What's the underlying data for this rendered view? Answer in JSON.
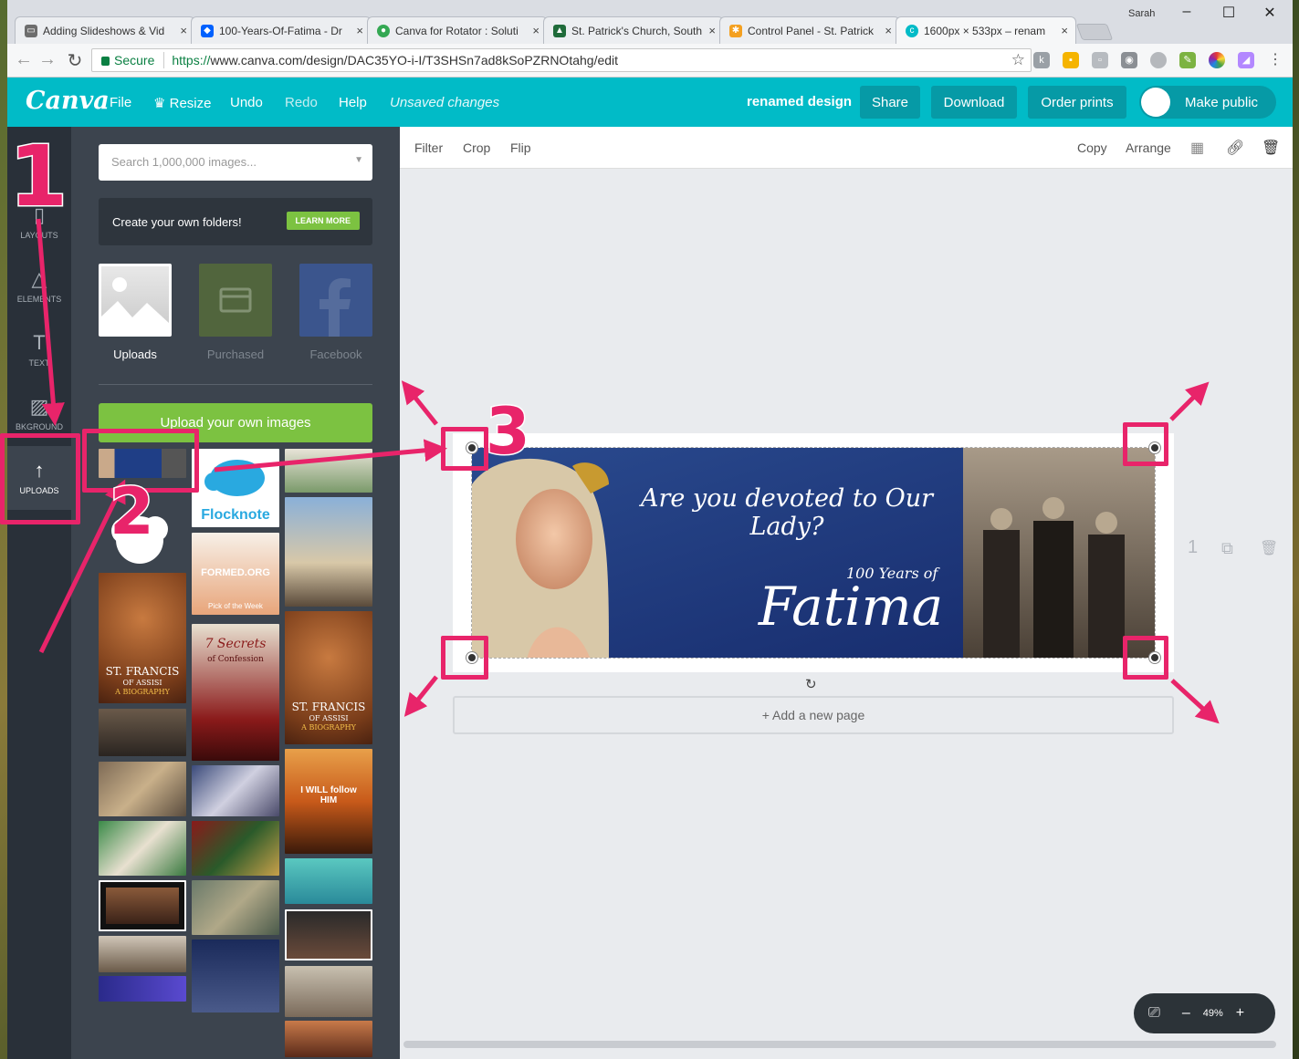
{
  "browser": {
    "tabs": [
      {
        "title": "Adding Slideshows & Vid",
        "fav_color": "#6d6d6d"
      },
      {
        "title": "100-Years-Of-Fatima - Dr",
        "fav_color": "#0061fe"
      },
      {
        "title": "Canva for Rotator : Soluti",
        "fav_color": "#34a853"
      },
      {
        "title": "St. Patrick's Church, South",
        "fav_color": "#1f6b3a"
      },
      {
        "title": "Control Panel - St. Patrick",
        "fav_color": "#f4a020"
      },
      {
        "title": "1600px × 533px – renam",
        "fav_color": "#01bbc7"
      }
    ],
    "close_glyph": "×",
    "profile_name": "Sarah",
    "secure_label": "Secure",
    "url_scheme": "https://",
    "url_rest": "www.canva.com/design/DAC35YO-i-I/T3SHSn7ad8kSoPZRNOtahg/edit"
  },
  "canva": {
    "logo": "Canva",
    "menu": {
      "file": "File",
      "resize": "Resize",
      "undo": "Undo",
      "redo": "Redo",
      "help": "Help",
      "status": "Unsaved changes"
    },
    "design_name": "renamed design",
    "buttons": {
      "share": "Share",
      "download": "Download",
      "order_prints": "Order prints",
      "make_public": "Make public"
    },
    "rail": {
      "layouts": "LAYOUTS",
      "elements": "ELEMENTS",
      "text": "TEXT",
      "background": "BKGROUND",
      "uploads": "UPLOADS"
    },
    "panel": {
      "search_placeholder": "Search 1,000,000 images...",
      "folders_text": "Create your own folders!",
      "learn_more": "LEARN MORE",
      "sources": {
        "uploads": "Uploads",
        "purchased": "Purchased",
        "facebook": "Facebook"
      },
      "upload_button": "Upload your own images",
      "thumb_texts": {
        "flocknote": "Flocknote",
        "formed": "FORMED.ORG",
        "formed_sub": "Pick of the Week",
        "francis_title": "ST. FRANCIS",
        "francis_sub": "OF ASSISI",
        "francis_bio": "A BIOGRAPHY",
        "secrets_title": "7 Secrets",
        "secrets_sub": "of Confession",
        "follow": "I WILL follow HIM"
      }
    },
    "toolbar": {
      "filter": "Filter",
      "crop": "Crop",
      "flip": "Flip",
      "copy": "Copy",
      "arrange": "Arrange"
    },
    "design": {
      "headline": "Are you devoted to Our Lady?",
      "years": "100 Years of",
      "fatima": "Fatima",
      "bg_color": "#1f3e86"
    },
    "add_page": "+ Add a new page",
    "page_number": "1",
    "zoom": {
      "minus": "–",
      "level": "49%",
      "plus": "+"
    }
  },
  "annotations": {
    "step1": "1",
    "step2": "2",
    "step3": "3",
    "color": "#e8246a"
  }
}
